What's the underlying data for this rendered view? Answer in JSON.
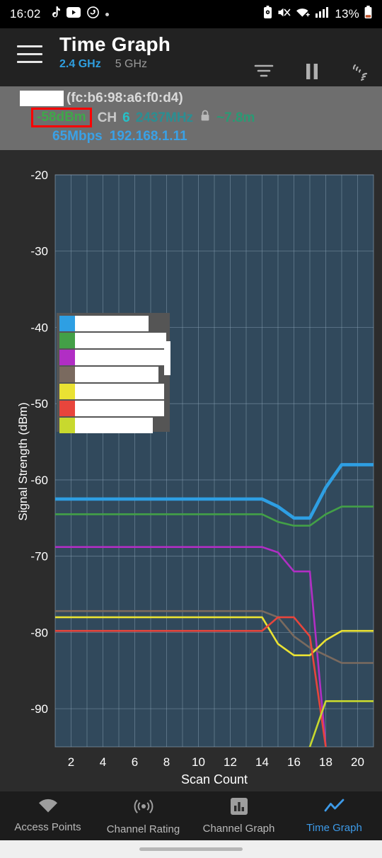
{
  "status_bar": {
    "clock": "16:02",
    "left_icons": [
      "tiktok-icon",
      "youtube-icon",
      "app-icon",
      "dot-indicator"
    ],
    "right_icons": [
      "battery-saver-icon",
      "mute-icon",
      "wifi-icon",
      "cellular-signal-icon"
    ],
    "battery_percent": "13%"
  },
  "app_bar": {
    "menu_icon": "hamburger-menu-icon",
    "title": "Time Graph",
    "bands": [
      {
        "label": "2.4 GHz",
        "active": true
      },
      {
        "label": "5 GHz",
        "active": false
      }
    ],
    "actions": [
      {
        "name": "filter-icon",
        "label": "Filter"
      },
      {
        "name": "pause-icon",
        "label": "Pause"
      },
      {
        "name": "scan-icon",
        "label": "Scan"
      }
    ]
  },
  "access_point": {
    "ssid_redacted": true,
    "bssid": "(fc:b6:98:a6:f0:d4)",
    "rssi": "-58dBm",
    "channel_label": "CH",
    "channel": "6",
    "frequency": "2437MHz",
    "security_icon": "lock-icon",
    "distance": "~7.8m",
    "link_speed": "65Mbps",
    "ip_address": "192.168.1.11"
  },
  "chart_data": {
    "type": "line",
    "title": "Time Graph",
    "xlabel": "Scan Count",
    "ylabel": "Signal Strength (dBm)",
    "xlim": [
      1,
      21
    ],
    "ylim": [
      -95,
      -20
    ],
    "xticks": [
      2,
      4,
      6,
      8,
      10,
      12,
      14,
      16,
      18,
      20
    ],
    "yticks": [
      -20,
      -30,
      -40,
      -50,
      -60,
      -70,
      -80,
      -90
    ],
    "grid": true,
    "legend_position": "top-left",
    "legend_redacted": true,
    "plot_bg": "#31495c",
    "x": [
      1,
      2,
      3,
      4,
      5,
      6,
      7,
      8,
      9,
      10,
      11,
      12,
      13,
      14,
      15,
      16,
      17,
      18,
      19,
      20,
      21
    ],
    "series": [
      {
        "name": "series-1",
        "color": "#2e9fe3",
        "legend_redacted": true,
        "values": [
          -62.5,
          -62.5,
          -62.5,
          -62.5,
          -62.5,
          -62.5,
          -62.5,
          -62.5,
          -62.5,
          -62.5,
          -62.5,
          -62.5,
          -62.5,
          -62.5,
          -63.5,
          -65,
          -65,
          -61,
          -58,
          -58,
          -58
        ]
      },
      {
        "name": "series-2",
        "color": "#43a047",
        "legend_redacted": true,
        "values": [
          -64.5,
          -64.5,
          -64.5,
          -64.5,
          -64.5,
          -64.5,
          -64.5,
          -64.5,
          -64.5,
          -64.5,
          -64.5,
          -64.5,
          -64.5,
          -64.5,
          -65.5,
          -66,
          -66,
          -64.5,
          -63.5,
          -63.5,
          -63.5
        ]
      },
      {
        "name": "series-3",
        "color": "#b12ec4",
        "legend_redacted": true,
        "values": [
          -68.8,
          -68.8,
          -68.8,
          -68.8,
          -68.8,
          -68.8,
          -68.8,
          -68.8,
          -68.8,
          -68.8,
          -68.8,
          -68.8,
          -68.8,
          -68.8,
          -69.5,
          -72,
          -72,
          -95,
          null,
          null,
          null
        ]
      },
      {
        "name": "series-4",
        "color": "#7a6a5f",
        "legend_redacted": true,
        "values": [
          -77.2,
          -77.2,
          -77.2,
          -77.2,
          -77.2,
          -77.2,
          -77.2,
          -77.2,
          -77.2,
          -77.2,
          -77.2,
          -77.2,
          -77.2,
          -77.2,
          -78,
          -80.5,
          -82,
          -83,
          -84,
          -84,
          -84
        ]
      },
      {
        "name": "series-5",
        "color": "#eae233",
        "legend_redacted": true,
        "values": [
          -78,
          -78,
          -78,
          -78,
          -78,
          -78,
          -78,
          -78,
          -78,
          -78,
          -78,
          -78,
          -78,
          -78,
          -81.5,
          -83,
          -83,
          -81,
          -79.8,
          -79.8,
          -79.8
        ]
      },
      {
        "name": "series-6",
        "color": "#e8453c",
        "legend_redacted": true,
        "values": [
          -79.8,
          -79.8,
          -79.8,
          -79.8,
          -79.8,
          -79.8,
          -79.8,
          -79.8,
          -79.8,
          -79.8,
          -79.8,
          -79.8,
          -79.8,
          -79.8,
          -78,
          -78,
          -80.5,
          -95,
          null,
          null,
          null
        ]
      },
      {
        "name": "series-7",
        "color": "#c8d92e",
        "legend_redacted": true,
        "values": [
          null,
          null,
          null,
          null,
          null,
          null,
          null,
          null,
          null,
          null,
          null,
          null,
          null,
          null,
          null,
          null,
          -95,
          -89,
          -89,
          -89,
          -89
        ]
      }
    ]
  },
  "bottom_nav": {
    "items": [
      {
        "label": "Access Points",
        "icon": "wifi-icon",
        "active": false
      },
      {
        "label": "Channel Rating",
        "icon": "radar-icon",
        "active": false
      },
      {
        "label": "Channel Graph",
        "icon": "bar-chart-icon",
        "active": false
      },
      {
        "label": "Time Graph",
        "icon": "line-chart-icon",
        "active": true
      }
    ],
    "active_color": "#3d9ae8"
  }
}
